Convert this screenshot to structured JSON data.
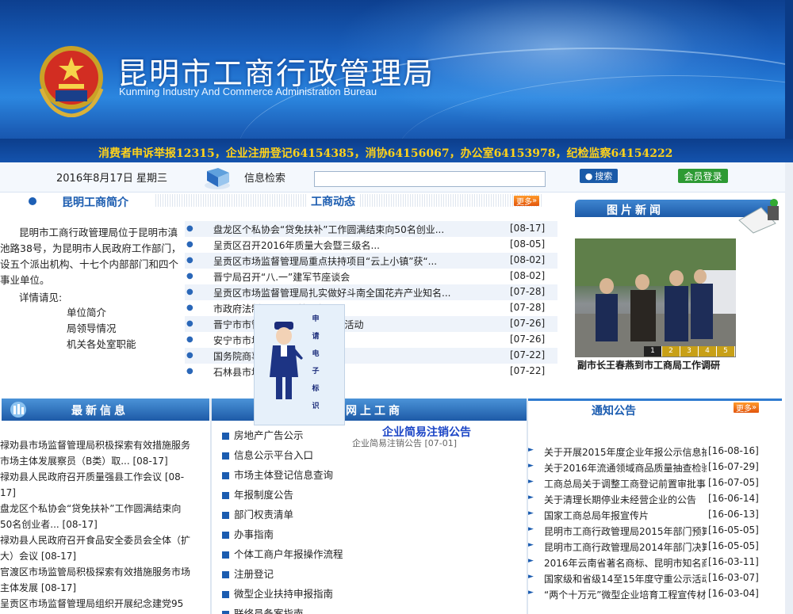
{
  "header": {
    "title_cn": "昆明市工商行政管理局",
    "title_en": "Kunming Industry And Commerce Administration Bureau",
    "hotline": "消费者申诉举报12315，企业注册登记64154385，消协64156067，办公室64153978，纪检监察64154222"
  },
  "search": {
    "date": "2016年8月17日  星期三",
    "label": "信息检索",
    "value": "",
    "search_button": "搜索",
    "login_button": "会员登录"
  },
  "intro": {
    "title": "昆明工商简介",
    "text": "昆明市工商行政管理局位于昆明市滇池路38号，为昆明市人民政府工作部门，设五个派出机构、十七个内部部门和四个事业单位。",
    "detail_label": "详情请见:",
    "links": [
      "单位简介",
      "局领导情况",
      "机关各处室职能"
    ]
  },
  "news": {
    "title": "工商动态",
    "more": "更多",
    "items": [
      {
        "text": "盘龙区个私协会“贷免扶补”工作圆满结束向50名创业...",
        "date": "[08-17]"
      },
      {
        "text": "呈贡区召开2016年质量大会暨三级名...",
        "date": "[08-05]"
      },
      {
        "text": "呈贡区市场监督管理局重点扶持项目“云上小镇”获“...",
        "date": "[08-02]"
      },
      {
        "text": "晋宁局召开“八.一”建军节座谈会",
        "date": "[08-02]"
      },
      {
        "text": "呈贡区市场监督管理局扎实做好斗南全国花卉产业知名...",
        "date": "[07-28]"
      },
      {
        "text": "市政府法制...开展...管局创...",
        "date": "[07-28]"
      },
      {
        "text": "晋宁市市管局...会战    冲制目标”活动",
        "date": "[07-26]"
      },
      {
        "text": "安宁市市场...“安...",
        "date": "[07-26]"
      },
      {
        "text": "国务院商事...昆明开展督查",
        "date": "[07-22]"
      },
      {
        "text": "石林县市场...把节...",
        "date": "[07-22]"
      }
    ]
  },
  "float_widget": {
    "text": "申请电子标识"
  },
  "photo_news": {
    "title": "图片新闻",
    "pages": [
      "1",
      "2",
      "3",
      "4",
      "5"
    ],
    "active_page": "1",
    "caption": "副市长王春燕到市工商局工作调研"
  },
  "latest": {
    "title": "最新信息",
    "items": [
      "禄劝县市场监督管理局积极探索有效措施服务市场主体发展察员（B类）取... [08-17]",
      "禄劝县人民政府召开质量强县工作会议 [08-17]",
      "盘龙区个私协会“贷免扶补”工作圆满结束向50名创业者... [08-17]",
      "禄劝县人民政府召开食品安全委员会全体（扩大）会议 [08-17]",
      "官渡区市场监管局积极探索有效措施服务市场主体发展 [08-17]",
      "呈贡区市场监督管理局组织开展纪念建党95"
    ]
  },
  "online": {
    "title": "网上工商",
    "services": [
      "房地产广告公示",
      "信息公示平台入口",
      "市场主体登记信息查询",
      "年报制度公告",
      "部门权责清单",
      "办事指南",
      "个体工商户年报操作流程",
      "注册登记",
      "微型企业扶持申报指南",
      "联络员备案指南"
    ],
    "cancel_title": "企业简易注销公告",
    "cancel_sub": "企业简易注销公告 [07-01]"
  },
  "notices": {
    "title": "通知公告",
    "more": "更多",
    "items": [
      {
        "text": "关于开展2015年度企业年报公示信息抽...",
        "date": "[16-08-16]"
      },
      {
        "text": "关于2016年流通领域商品质量抽查检验...",
        "date": "[16-07-29]"
      },
      {
        "text": "工商总局关于调整工商登记前置审批事...",
        "date": "[16-07-05]"
      },
      {
        "text": "关于清理长期停业未经营企业的公告",
        "date": "[16-06-14]"
      },
      {
        "text": "国家工商总局年报宣传片",
        "date": "[16-06-13]"
      },
      {
        "text": "昆明市工商行政管理局2015年部门预算...",
        "date": "[16-05-05]"
      },
      {
        "text": "昆明市工商行政管理局2014年部门决算...",
        "date": "[16-05-05]"
      },
      {
        "text": "2016年云南省著名商标、昆明市知名商...",
        "date": "[16-03-11]"
      },
      {
        "text": "国家级和省级14至15年度守重公示活动...",
        "date": "[16-03-07]"
      },
      {
        "text": "“两个十万元”微型企业培育工程宣传材...",
        "date": "[16-03-04]"
      }
    ]
  }
}
